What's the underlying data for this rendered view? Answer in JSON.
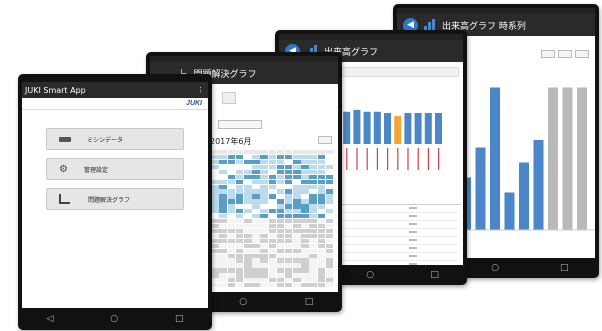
{
  "tablet1": {
    "title": "JUKI Smart App",
    "logo": "JUKI",
    "menu": [
      {
        "label": "ミシンデータ",
        "icon": "sewing-machine-icon"
      },
      {
        "label": "管理設定",
        "icon": "gear-icon"
      },
      {
        "label": "問題解決グラフ",
        "icon": "graph-icon"
      }
    ],
    "nav": {
      "back": "◁",
      "home": "○",
      "recent": "□"
    }
  },
  "tablet2": {
    "title": "問題解決グラフ",
    "month": "2017年6月"
  },
  "tablet3": {
    "title": "出来高グラフ"
  },
  "tablet4": {
    "title": "出来高グラフ 時系列"
  },
  "colors": {
    "bar_blue": "#4a86c8",
    "bar_orange": "#f2a534",
    "bar_gray": "#b9b9b9",
    "heat_dark": "#5a9ec5",
    "heat_light": "#bcdcec",
    "appbar": "#2a2a2a",
    "accent": "#2f77c9"
  }
}
